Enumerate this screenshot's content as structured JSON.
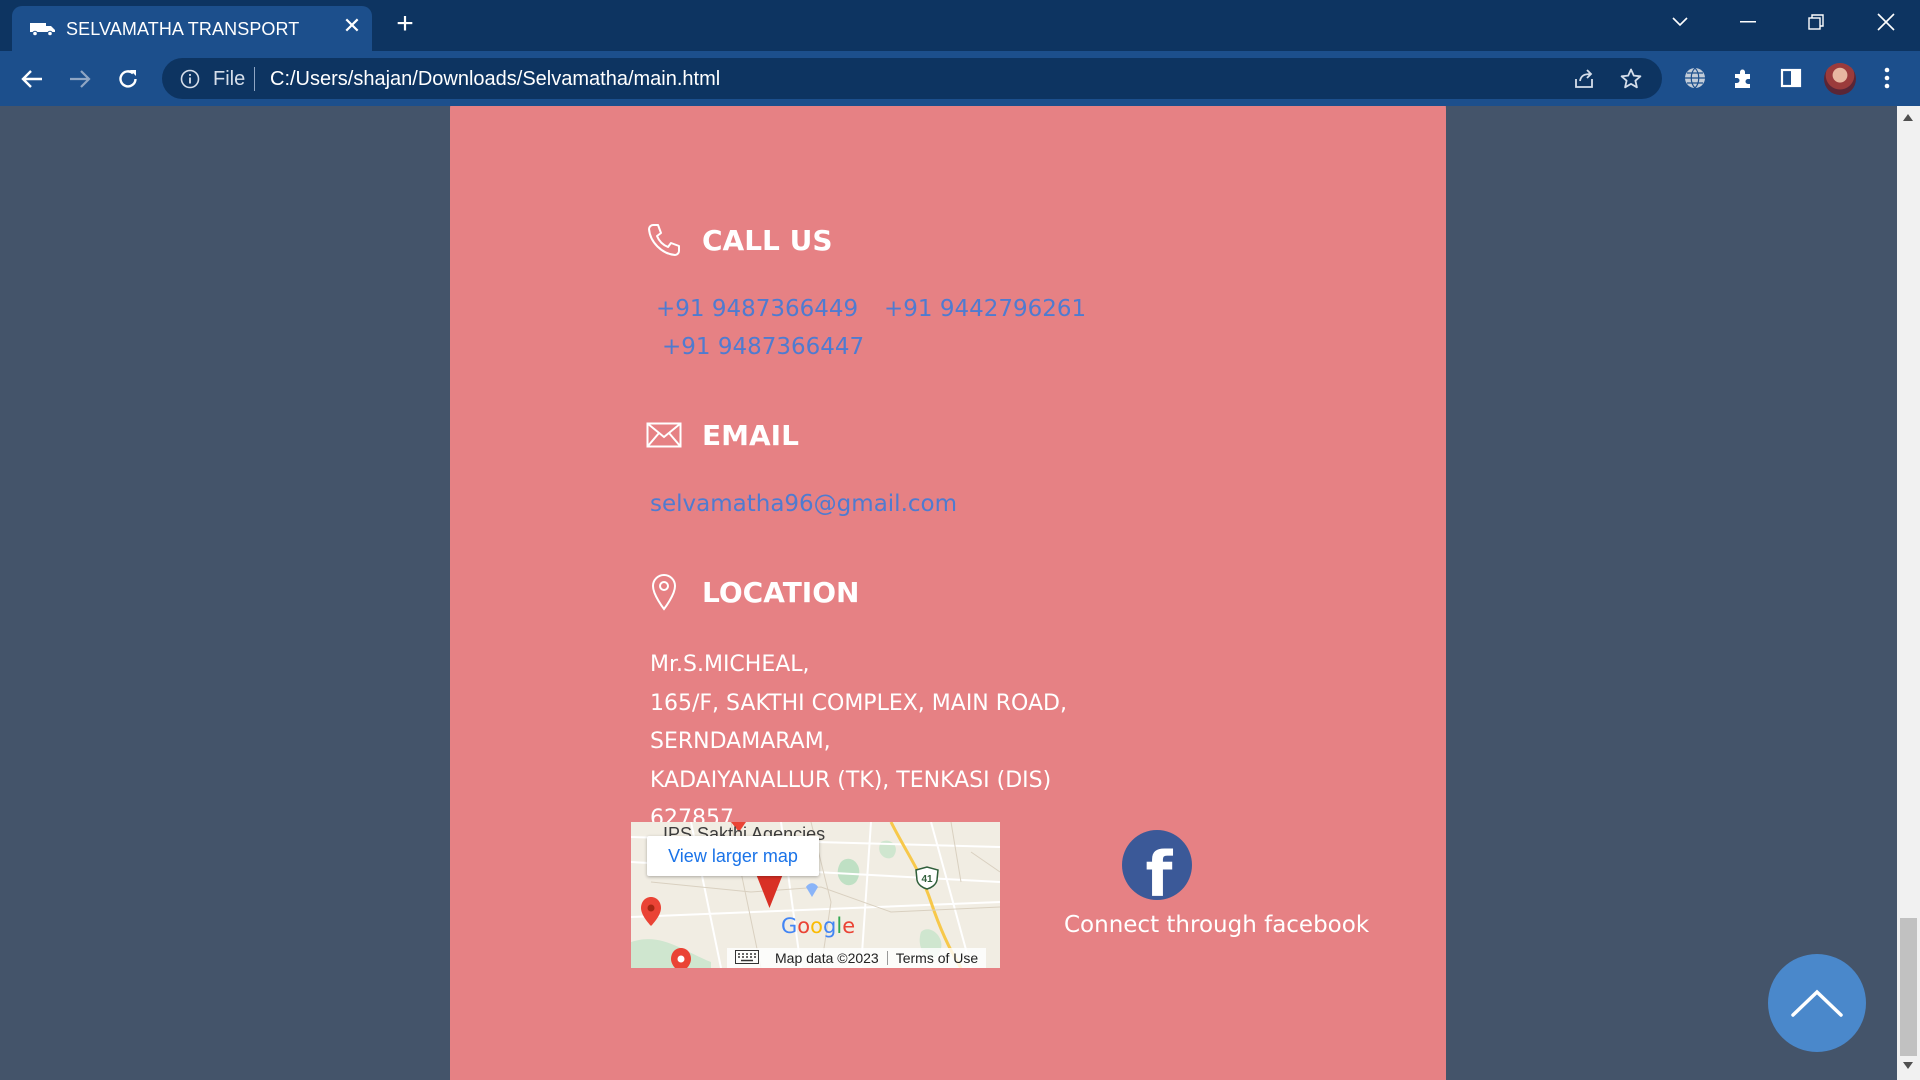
{
  "browser": {
    "tab_title": "SELVAMATHA TRANSPORT",
    "tab_close": "✕",
    "new_tab": "+",
    "omnibox_scheme": "File",
    "url": "C:/Users/shajan/Downloads/Selvamatha/main.html"
  },
  "contact": {
    "call": {
      "heading": "CALL US",
      "phones": [
        "+91 9487366449",
        "+91 9442796261",
        "+91 9487366447"
      ]
    },
    "email": {
      "heading": "EMAIL",
      "address": "selvamatha96@gmail.com"
    },
    "location": {
      "heading": "LOCATION",
      "lines": [
        "Mr.S.MICHEAL,",
        "165/F, SAKTHI COMPLEX, MAIN ROAD,",
        "SERNDAMARAM,",
        "KADAIYANALLUR (TK), TENKASI (DIS)",
        "627857."
      ]
    },
    "map": {
      "place_label": "IPS Sakthi Agencies",
      "larger_map": "View larger map",
      "brand": "Google",
      "route_number": "41",
      "map_data": "Map data ©2023",
      "terms": "Terms of Use"
    },
    "facebook": {
      "label": "Connect through facebook",
      "glyph": "f"
    }
  },
  "colors": {
    "page_bg": "#44546a",
    "card_bg": "#e68184",
    "link": "#4f7bd0",
    "heading": "#ffffff",
    "facebook": "#3b5998",
    "scroll_top": "#4a88cb",
    "chrome_dark": "#0d3461",
    "chrome_light": "#1c4f8c"
  }
}
